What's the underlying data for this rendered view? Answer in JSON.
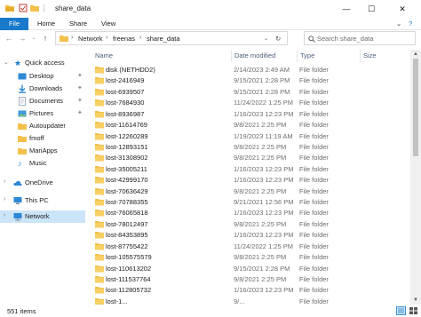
{
  "window": {
    "title": "share_data",
    "minimize": "—",
    "maximize": "☐",
    "close": "✕"
  },
  "ribbon": {
    "file": "File",
    "home": "Home",
    "share": "Share",
    "view": "View"
  },
  "address": {
    "breadcrumbs": [
      "Network",
      "freenas",
      "share_data"
    ],
    "search_placeholder": "Search share_data"
  },
  "nav": {
    "quick_access": "Quick access",
    "items": [
      {
        "label": "Desktop",
        "pinned": true
      },
      {
        "label": "Downloads",
        "pinned": true
      },
      {
        "label": "Documents",
        "pinned": true
      },
      {
        "label": "Pictures",
        "pinned": true
      },
      {
        "label": "Autoupdater",
        "pinned": false
      },
      {
        "label": "fmoff",
        "pinned": false
      },
      {
        "label": "MariApps",
        "pinned": false
      },
      {
        "label": "Music",
        "pinned": false
      }
    ],
    "onedrive": "OneDrive",
    "this_pc": "This PC",
    "network": "Network"
  },
  "columns": {
    "name": "Name",
    "date": "Date modified",
    "type": "Type",
    "size": "Size"
  },
  "files": [
    {
      "name": "disk (NETHDD2)",
      "date": "2/14/2023 2:49 AM",
      "type": "File folder"
    },
    {
      "name": "lost-2416949",
      "date": "9/15/2021 2:28 PM",
      "type": "File folder"
    },
    {
      "name": "lost-6939507",
      "date": "9/15/2021 2:28 PM",
      "type": "File folder"
    },
    {
      "name": "lost-7684930",
      "date": "11/24/2022 1:25 PM",
      "type": "File folder"
    },
    {
      "name": "lost-8936987",
      "date": "1/16/2023 12:23 PM",
      "type": "File folder"
    },
    {
      "name": "lost-11614769",
      "date": "9/8/2021 2:25 PM",
      "type": "File folder"
    },
    {
      "name": "lost-12260289",
      "date": "1/19/2023 11:19 AM",
      "type": "File folder"
    },
    {
      "name": "lost-12893151",
      "date": "9/8/2021 2:25 PM",
      "type": "File folder"
    },
    {
      "name": "lost-31308902",
      "date": "9/8/2021 2:25 PM",
      "type": "File folder"
    },
    {
      "name": "lost-35005211",
      "date": "1/16/2023 12:23 PM",
      "type": "File folder"
    },
    {
      "name": "lost-42999170",
      "date": "1/16/2023 12:23 PM",
      "type": "File folder"
    },
    {
      "name": "lost-70636429",
      "date": "9/8/2021 2:25 PM",
      "type": "File folder"
    },
    {
      "name": "lost-70788355",
      "date": "9/21/2021 12:56 PM",
      "type": "File folder"
    },
    {
      "name": "lost-76065818",
      "date": "1/16/2023 12:23 PM",
      "type": "File folder"
    },
    {
      "name": "lost-78012497",
      "date": "9/8/2021 2:25 PM",
      "type": "File folder"
    },
    {
      "name": "lost-84353895",
      "date": "1/16/2023 12:23 PM",
      "type": "File folder"
    },
    {
      "name": "lost-87755422",
      "date": "11/24/2022 1:25 PM",
      "type": "File folder"
    },
    {
      "name": "lost-105575579",
      "date": "9/8/2021 2:25 PM",
      "type": "File folder"
    },
    {
      "name": "lost-110613202",
      "date": "9/15/2021 2:28 PM",
      "type": "File folder"
    },
    {
      "name": "lost-111537764",
      "date": "9/8/2021 2:25 PM",
      "type": "File folder"
    },
    {
      "name": "lost-112805732",
      "date": "1/16/2023 12:23 PM",
      "type": "File folder"
    },
    {
      "name": "lost-1...",
      "date": "9/...",
      "type": "File folder"
    }
  ],
  "status": {
    "count": "551 items"
  },
  "colors": {
    "accent": "#1979ca",
    "folder": "#f3c14b",
    "selected": "#cce4f7"
  }
}
